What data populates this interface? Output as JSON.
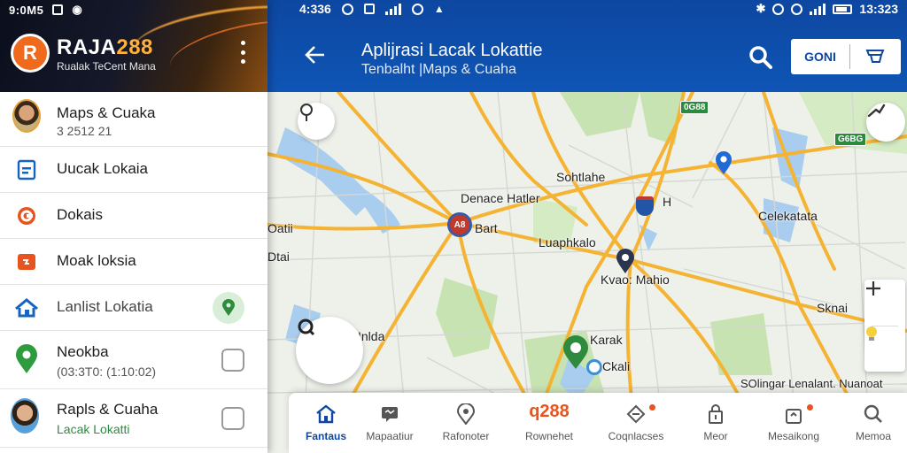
{
  "drawer": {
    "status_time": "9:0M5",
    "brand": {
      "name_prefix": "RAJA",
      "name_number": "288",
      "tagline": "Rualak TeCent Mana",
      "logo_letter": "R"
    },
    "items": [
      {
        "label": "Maps & Cuaka",
        "sub": "3 2512 21",
        "icon": "avatar"
      },
      {
        "label": "Uucak Lokaia",
        "icon": "document-icon"
      },
      {
        "label": "Dokais",
        "icon": "copyright-icon"
      },
      {
        "label": "Moak loksia",
        "icon": "store-icon"
      },
      {
        "label": "Lanlist Lokatia",
        "icon": "home-icon",
        "trail": "pin-badge"
      },
      {
        "label": "Neokba",
        "sub": "(03:3T0: (1:10:02)",
        "icon": "map-pin-icon",
        "trail": "box"
      },
      {
        "label": "Rapls & Cuaha",
        "sub": "Lacak Lokatti",
        "icon": "avatar",
        "trail": "box"
      }
    ]
  },
  "appbar": {
    "status_time_left": "4:336",
    "status_time_right": "13:323",
    "title": "Aplijrasi Lacak Lokattie",
    "subtitle": "Tenbalht |Maps & Cuaha",
    "cta_label": "GONI"
  },
  "map": {
    "labels": [
      {
        "text": "Sohtlahe"
      },
      {
        "text": "Denace Hatler"
      },
      {
        "text": "Bart"
      },
      {
        "text": "Luaphkalo"
      },
      {
        "text": "Celekatata"
      },
      {
        "text": "Kvao: Mahio"
      },
      {
        "text": "Karak"
      },
      {
        "text": "Ckali"
      },
      {
        "text": "Inlda"
      },
      {
        "text": "Dtai"
      },
      {
        "text": "Oatii"
      },
      {
        "text": "Sknai"
      },
      {
        "text": "SOlingar Lenalant. Nuanoat"
      },
      {
        "text": "H"
      }
    ],
    "road_badges": [
      "0G88",
      "G6BG",
      "A8"
    ],
    "colors": {
      "road": "#f5b333",
      "water": "#a9cdee",
      "park": "#c6e3b1",
      "land": "#eef0ea"
    }
  },
  "bottomnav": {
    "items": [
      {
        "label": "Fantaus",
        "icon": "home-icon",
        "active": true
      },
      {
        "label": "Mapaatiur",
        "icon": "message-icon"
      },
      {
        "label": "Rafonoter",
        "icon": "location-icon"
      },
      {
        "label": "Rownehet",
        "icon": "brand-logo",
        "brand": "q288"
      },
      {
        "label": "Coqnlacses",
        "icon": "shield-icon"
      },
      {
        "label": "Meor",
        "icon": "lock-icon"
      },
      {
        "label": "Mesaikong",
        "icon": "bag-icon"
      },
      {
        "label": "Memoa",
        "icon": "search-icon"
      }
    ]
  }
}
